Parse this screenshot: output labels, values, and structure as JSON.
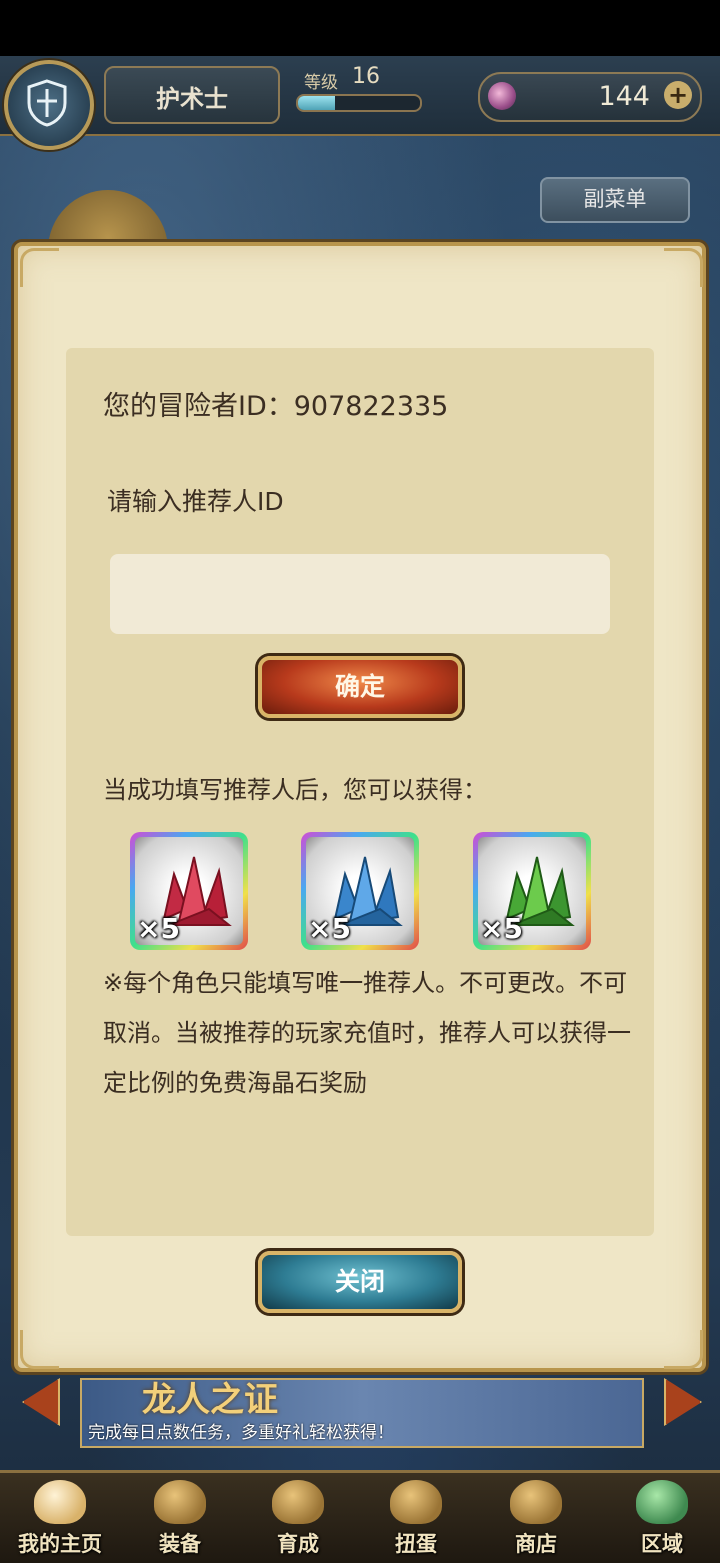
{
  "header": {
    "character_name": "护术士",
    "level_label": "等级",
    "level_value": "16",
    "level_progress": 0.3,
    "currency_amount": "144",
    "currency_plus": "+",
    "submenu_label": "副菜单"
  },
  "dialog": {
    "adventurer_id_text": "您的冒险者ID：907822335",
    "prompt_label": "请输入推荐人ID",
    "input_value": "",
    "confirm_label": "确定",
    "reward_desc": "当成功填写推荐人后，您可以获得：",
    "rewards": [
      {
        "icon": "red-crystal-icon",
        "color": "#d2394f",
        "qty": "×5"
      },
      {
        "icon": "blue-crystal-icon",
        "color": "#3d8fd6",
        "qty": "×5"
      },
      {
        "icon": "green-crystal-icon",
        "color": "#4fb23a",
        "qty": "×5"
      }
    ],
    "note": "※每个角色只能填写唯一推荐人。不可更改。不可取消。当被推荐的玩家充值时，推荐人可以获得一定比例的免费海晶石奖励",
    "close_label": "关闭"
  },
  "banner": {
    "title": "龙人之证",
    "subtitle": "完成每日点数任务，多重好礼轻松获得！"
  },
  "nav": {
    "items": [
      {
        "label": "我的主页"
      },
      {
        "label": "装备"
      },
      {
        "label": "育成"
      },
      {
        "label": "扭蛋"
      },
      {
        "label": "商店"
      },
      {
        "label": "区域"
      }
    ]
  }
}
